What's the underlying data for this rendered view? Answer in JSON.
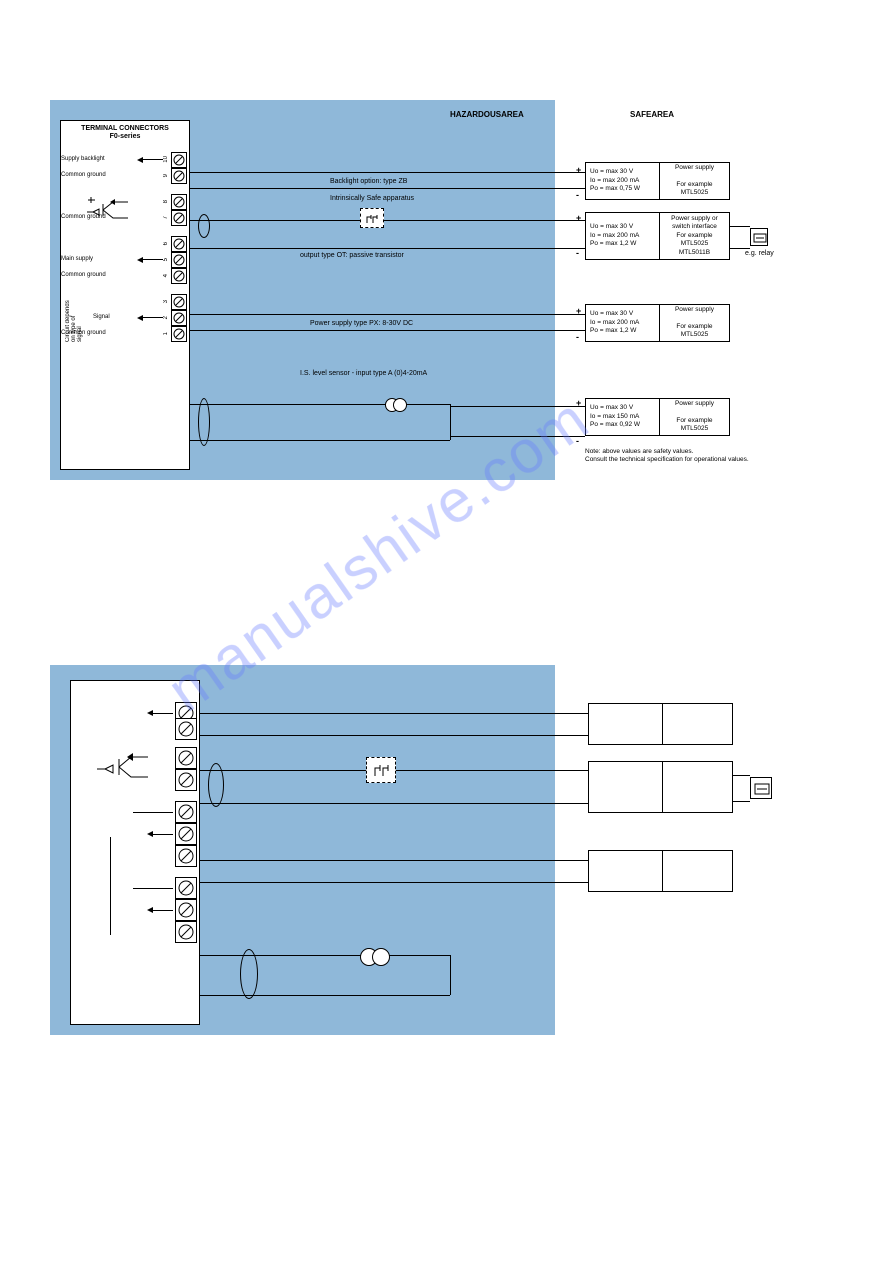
{
  "headings": {
    "hazardous": "HAZARDOUSAREA",
    "safe": "SAFEAREA"
  },
  "terminal": {
    "title_line1": "TERMINAL CONNECTORS",
    "title_line2": "F0-series",
    "supply_backlight": "Supply backlight",
    "common_ground": "Common ground",
    "main_supply": "Main supply",
    "signal": "Signal",
    "depends": "Circuit depends on type of signal",
    "n1": "1",
    "n2": "2",
    "n3": "3",
    "n4": "4",
    "n5": "5",
    "n6": "6",
    "n7": "7",
    "n8": "8",
    "n9": "9",
    "n10": "10"
  },
  "field": {
    "backlight_option": "Backlight option: type ZB",
    "is_apparatus": "Intrinsically Safe apparatus",
    "output_ot": "output type OT: passive transistor",
    "power_px": "Power supply type PX: 8-30V DC",
    "sensor": "I.S. level sensor - input type A (0)4-20mA"
  },
  "safe_boxes": {
    "b1": {
      "uo": "Uo = max 30 V",
      "io": "Io  = max 200 mA",
      "po": "Po = max 0,75 W",
      "title": "Power supply",
      "eg": "For example",
      "model": "MTL5025"
    },
    "b2": {
      "uo": "Uo = max 30 V",
      "io": "Io  = max 200 mA",
      "po": "Po = max 1,2 W",
      "title": "Power supply or switch interface",
      "eg": "For example",
      "model": "MTL5025",
      "model2": "MTL5011B",
      "relay": "e.g. relay"
    },
    "b3": {
      "uo": "Uo = max 30 V",
      "io": "Io  = max 200 mA",
      "po": "Po = max 1,2 W",
      "title": "Power supply",
      "eg": "For example",
      "model": "MTL5025"
    },
    "b4": {
      "uo": "Uo = max 30 V",
      "io": "Io  = max 150 mA",
      "po": "Po = max 0,92 W",
      "title": "Power supply",
      "eg": "For example",
      "model": "MTL5025"
    }
  },
  "note": {
    "l1": "Note: above values are safety values.",
    "l2": "Consult the technical specification for operational values."
  },
  "plus": "+",
  "minus": "-",
  "watermark": "manualshive.com"
}
